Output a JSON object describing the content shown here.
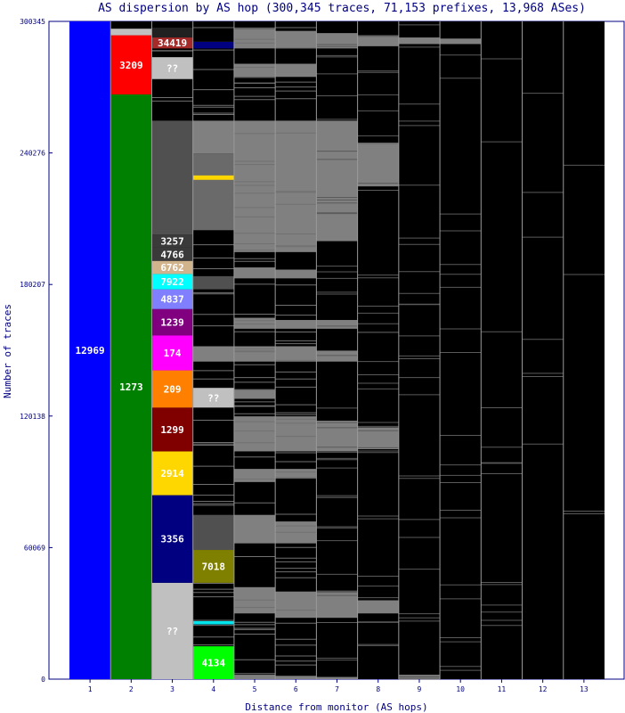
{
  "chart_data": {
    "type": "stacked-bar",
    "title": "AS dispersion by AS hop (300,345 traces, 71,153 prefixes, 13,968 ASes)",
    "xlabel": "Distance from monitor (AS hops)",
    "ylabel": "Number of traces",
    "ylim": [
      0,
      300345
    ],
    "yticks": [
      "0",
      "60069",
      "120138",
      "180207",
      "240276",
      "300345"
    ],
    "yticks_values": [
      0,
      60069,
      120138,
      180207,
      240276,
      300345
    ],
    "categories": [
      "1",
      "2",
      "3",
      "4",
      "5",
      "6",
      "7",
      "8",
      "9",
      "10",
      "11",
      "12",
      "13"
    ],
    "background_color": "#000000",
    "label_color": "#000080",
    "segments": [
      {
        "hop": 1,
        "label": "12969",
        "from": 0,
        "to": 300345,
        "color": "#0000ff",
        "text_color": "#ffffff"
      },
      {
        "hop": 2,
        "label": "1273",
        "from": 0,
        "to": 267000,
        "color": "#008000",
        "text_color": "#ffffff"
      },
      {
        "hop": 2,
        "label": "3209",
        "from": 267000,
        "to": 294000,
        "color": "#ff0000",
        "text_color": "#ffffff"
      },
      {
        "hop": 2,
        "label": "",
        "from": 294000,
        "to": 297000,
        "color": "#c0c0c0",
        "text_color": "#ffffff"
      },
      {
        "hop": 3,
        "label": "??",
        "from": 0,
        "to": 44000,
        "color": "#c0c0c0",
        "text_color": "#ffffff"
      },
      {
        "hop": 3,
        "label": "3356",
        "from": 44000,
        "to": 84000,
        "color": "#000080",
        "text_color": "#ffffff"
      },
      {
        "hop": 3,
        "label": "2914",
        "from": 84000,
        "to": 104000,
        "color": "#ffd700",
        "text_color": "#ffffff"
      },
      {
        "hop": 3,
        "label": "1299",
        "from": 104000,
        "to": 124000,
        "color": "#800000",
        "text_color": "#ffffff"
      },
      {
        "hop": 3,
        "label": "209",
        "from": 124000,
        "to": 141000,
        "color": "#ff8000",
        "text_color": "#ffffff"
      },
      {
        "hop": 3,
        "label": "174",
        "from": 141000,
        "to": 157000,
        "color": "#ff00ff",
        "text_color": "#ffffff"
      },
      {
        "hop": 3,
        "label": "1239",
        "from": 157000,
        "to": 169000,
        "color": "#800080",
        "text_color": "#ffffff"
      },
      {
        "hop": 3,
        "label": "4837",
        "from": 169000,
        "to": 178000,
        "color": "#8080ff",
        "text_color": "#ffffff"
      },
      {
        "hop": 3,
        "label": "7922",
        "from": 178000,
        "to": 185000,
        "color": "#00ffff",
        "text_color": "#ffffff"
      },
      {
        "hop": 3,
        "label": "6762",
        "from": 185000,
        "to": 191000,
        "color": "#d2b48c",
        "text_color": "#ffffff"
      },
      {
        "hop": 3,
        "label": "4766",
        "from": 191000,
        "to": 197000,
        "color": "#3a3a3a",
        "text_color": "#ffffff"
      },
      {
        "hop": 3,
        "label": "3257",
        "from": 197000,
        "to": 203000,
        "color": "#3a3a3a",
        "text_color": "#ffffff"
      },
      {
        "hop": 3,
        "label": "",
        "from": 203000,
        "to": 255000,
        "color": "#505050",
        "text_color": "#ffffff"
      },
      {
        "hop": 3,
        "label": "??",
        "from": 274000,
        "to": 284000,
        "color": "#c0c0c0",
        "text_color": "#ffffff"
      },
      {
        "hop": 3,
        "label": "34419",
        "from": 288000,
        "to": 293000,
        "color": "#a52a2a",
        "text_color": "#ffffff"
      },
      {
        "hop": 3,
        "label": "",
        "from": 293000,
        "to": 297500,
        "color": "#202020",
        "text_color": "#ffffff"
      },
      {
        "hop": 4,
        "label": "4134",
        "from": 0,
        "to": 15000,
        "color": "#00ff00",
        "text_color": "#ffffff"
      },
      {
        "hop": 4,
        "label": "",
        "from": 25000,
        "to": 26500,
        "color": "#00e5ee",
        "text_color": "#ffffff"
      },
      {
        "hop": 4,
        "label": "7018",
        "from": 44000,
        "to": 59000,
        "color": "#808000",
        "text_color": "#ffffff"
      },
      {
        "hop": 4,
        "label": "",
        "from": 59000,
        "to": 75000,
        "color": "#505050",
        "text_color": "#ffffff"
      },
      {
        "hop": 4,
        "label": "??",
        "from": 124000,
        "to": 133000,
        "color": "#c0c0c0",
        "text_color": "#ffffff"
      },
      {
        "hop": 4,
        "label": "",
        "from": 145000,
        "to": 152000,
        "color": "#808080",
        "text_color": "#ffffff"
      },
      {
        "hop": 4,
        "label": "",
        "from": 178000,
        "to": 184000,
        "color": "#505050",
        "text_color": "#ffffff"
      },
      {
        "hop": 4,
        "label": "",
        "from": 205000,
        "to": 240000,
        "color": "#6a6a6a",
        "text_color": "#ffffff"
      },
      {
        "hop": 4,
        "label": "",
        "from": 228000,
        "to": 230000,
        "color": "#ffd700",
        "text_color": "#ffffff"
      },
      {
        "hop": 4,
        "label": "",
        "from": 240000,
        "to": 255000,
        "color": "#808080",
        "text_color": "#ffffff"
      },
      {
        "hop": 4,
        "label": "",
        "from": 288000,
        "to": 291000,
        "color": "#000080",
        "text_color": "#ffffff"
      }
    ],
    "gray_blocks": [
      {
        "hop": 5,
        "from": 0,
        "to": 2000
      },
      {
        "hop": 5,
        "from": 30000,
        "to": 42000
      },
      {
        "hop": 5,
        "from": 62000,
        "to": 75000
      },
      {
        "hop": 5,
        "from": 90000,
        "to": 96000
      },
      {
        "hop": 5,
        "from": 104000,
        "to": 120000
      },
      {
        "hop": 5,
        "from": 128000,
        "to": 132000
      },
      {
        "hop": 5,
        "from": 145000,
        "to": 152000
      },
      {
        "hop": 5,
        "from": 160000,
        "to": 165000
      },
      {
        "hop": 5,
        "from": 183000,
        "to": 188000
      },
      {
        "hop": 5,
        "from": 195000,
        "to": 255000
      },
      {
        "hop": 5,
        "from": 275000,
        "to": 281000
      },
      {
        "hop": 5,
        "from": 288000,
        "to": 297000
      },
      {
        "hop": 6,
        "from": 0,
        "to": 1500
      },
      {
        "hop": 6,
        "from": 28000,
        "to": 40000
      },
      {
        "hop": 6,
        "from": 62000,
        "to": 72000
      },
      {
        "hop": 6,
        "from": 92000,
        "to": 96000
      },
      {
        "hop": 6,
        "from": 104000,
        "to": 120000
      },
      {
        "hop": 6,
        "from": 145000,
        "to": 152000
      },
      {
        "hop": 6,
        "from": 160000,
        "to": 164000
      },
      {
        "hop": 6,
        "from": 183000,
        "to": 187000
      },
      {
        "hop": 6,
        "from": 195000,
        "to": 255000
      },
      {
        "hop": 6,
        "from": 275000,
        "to": 281000
      },
      {
        "hop": 6,
        "from": 288000,
        "to": 296000
      },
      {
        "hop": 7,
        "from": 0,
        "to": 1000
      },
      {
        "hop": 7,
        "from": 28000,
        "to": 40000
      },
      {
        "hop": 7,
        "from": 104000,
        "to": 118000
      },
      {
        "hop": 7,
        "from": 145000,
        "to": 150000
      },
      {
        "hop": 7,
        "from": 160000,
        "to": 164000
      },
      {
        "hop": 7,
        "from": 200000,
        "to": 255000
      },
      {
        "hop": 7,
        "from": 288000,
        "to": 295000
      },
      {
        "hop": 8,
        "from": 30000,
        "to": 36000
      },
      {
        "hop": 8,
        "from": 105000,
        "to": 115000
      },
      {
        "hop": 8,
        "from": 225000,
        "to": 245000
      },
      {
        "hop": 8,
        "from": 289000,
        "to": 294000
      },
      {
        "hop": 9,
        "from": 0,
        "to": 2000
      },
      {
        "hop": 9,
        "from": 290000,
        "to": 293000
      },
      {
        "hop": 10,
        "from": 290000,
        "to": 292500
      }
    ]
  }
}
